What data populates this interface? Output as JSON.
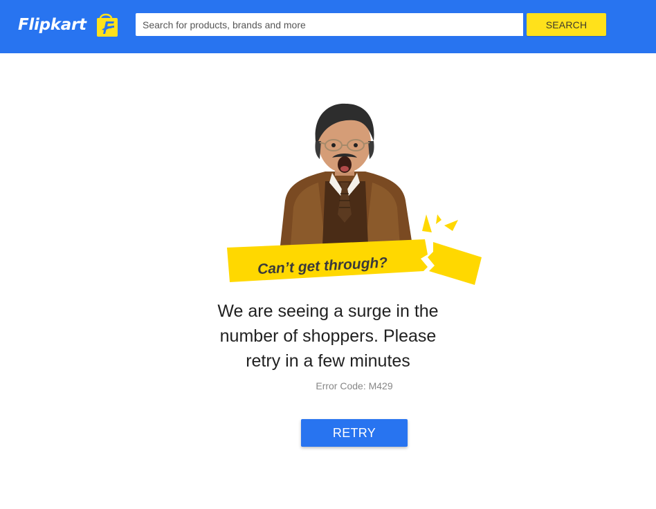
{
  "header": {
    "logo_text": "Flipkart",
    "logo_icon": "shopping-bag-f-icon",
    "search_placeholder": "Search for products, brands and more",
    "search_value": "",
    "search_button_label": "SEARCH"
  },
  "error": {
    "banner_text": "Can’t get through?",
    "message_line1": "We are seeing a surge in the",
    "message_line2": "number of shoppers. Please",
    "message_line3": "retry in a few minutes",
    "error_code": "Error Code: M429",
    "retry_label": "RETRY"
  },
  "colors": {
    "brand_blue": "#2874f0",
    "brand_yellow": "#ffe11b",
    "banner_yellow": "#ffd800",
    "text_dark": "#212121",
    "text_muted": "#878787"
  }
}
